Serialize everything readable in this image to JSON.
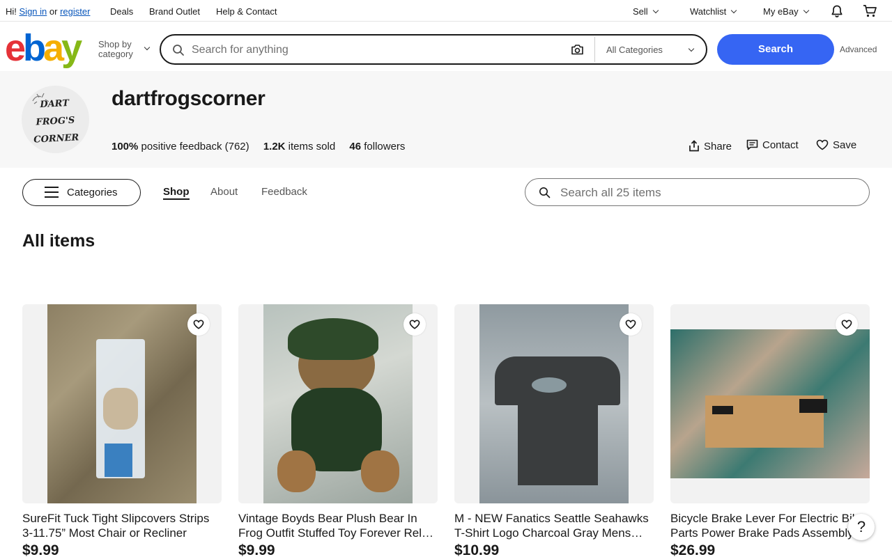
{
  "topbar": {
    "greeting": "Hi!",
    "sign_in": "Sign in",
    "or": "or",
    "register": "register",
    "deals": "Deals",
    "brand_outlet": "Brand Outlet",
    "help": "Help & Contact",
    "sell": "Sell",
    "watchlist": "Watchlist",
    "my_ebay": "My eBay",
    "bell_icon": "bell-icon",
    "cart_icon": "cart-icon"
  },
  "header": {
    "logo": [
      "e",
      "b",
      "a",
      "y"
    ],
    "shop_by_line1": "Shop by",
    "shop_by_line2": "category",
    "search_placeholder": "Search for anything",
    "category_select": "All Categories",
    "search_button": "Search",
    "advanced": "Advanced"
  },
  "store": {
    "avatar_lines": [
      "DART",
      "FROG'S",
      "CORNER"
    ],
    "name": "dartfrogscorner",
    "feedback_value": "100%",
    "feedback_label": "positive feedback (762)",
    "sold_value": "1.2K",
    "sold_label": "items sold",
    "followers_value": "46",
    "followers_label": "followers",
    "share": "Share",
    "contact": "Contact",
    "save": "Save"
  },
  "store_nav": {
    "categories": "Categories",
    "tabs": [
      "Shop",
      "About",
      "Feedback"
    ],
    "active_tab": "Shop",
    "search_placeholder": "Search all 25 items"
  },
  "section_title": "All items",
  "items": [
    {
      "title": "SureFit Tuck Tight Slipcovers Strips 3-11.75” Most Chair or Recliner",
      "price": "$9.99"
    },
    {
      "title": "Vintage Boyds Bear Plush Bear In Frog Outfit Stuffed Toy Forever Rel…",
      "price": "$9.99"
    },
    {
      "title": "M - NEW Fanatics Seattle Seahawks T-Shirt Logo Charcoal Gray Mens…",
      "price": "$10.99"
    },
    {
      "title": "Bicycle Brake Lever For Electric Bike Parts Power Brake Pads Assembly",
      "price": "$26.99"
    }
  ],
  "help_label": "?",
  "colors": {
    "accent": "#3665f3",
    "link": "#0654ba",
    "logo_e": "#e53238",
    "logo_b": "#0064d2",
    "logo_a": "#f5af02",
    "logo_y": "#86b817"
  }
}
